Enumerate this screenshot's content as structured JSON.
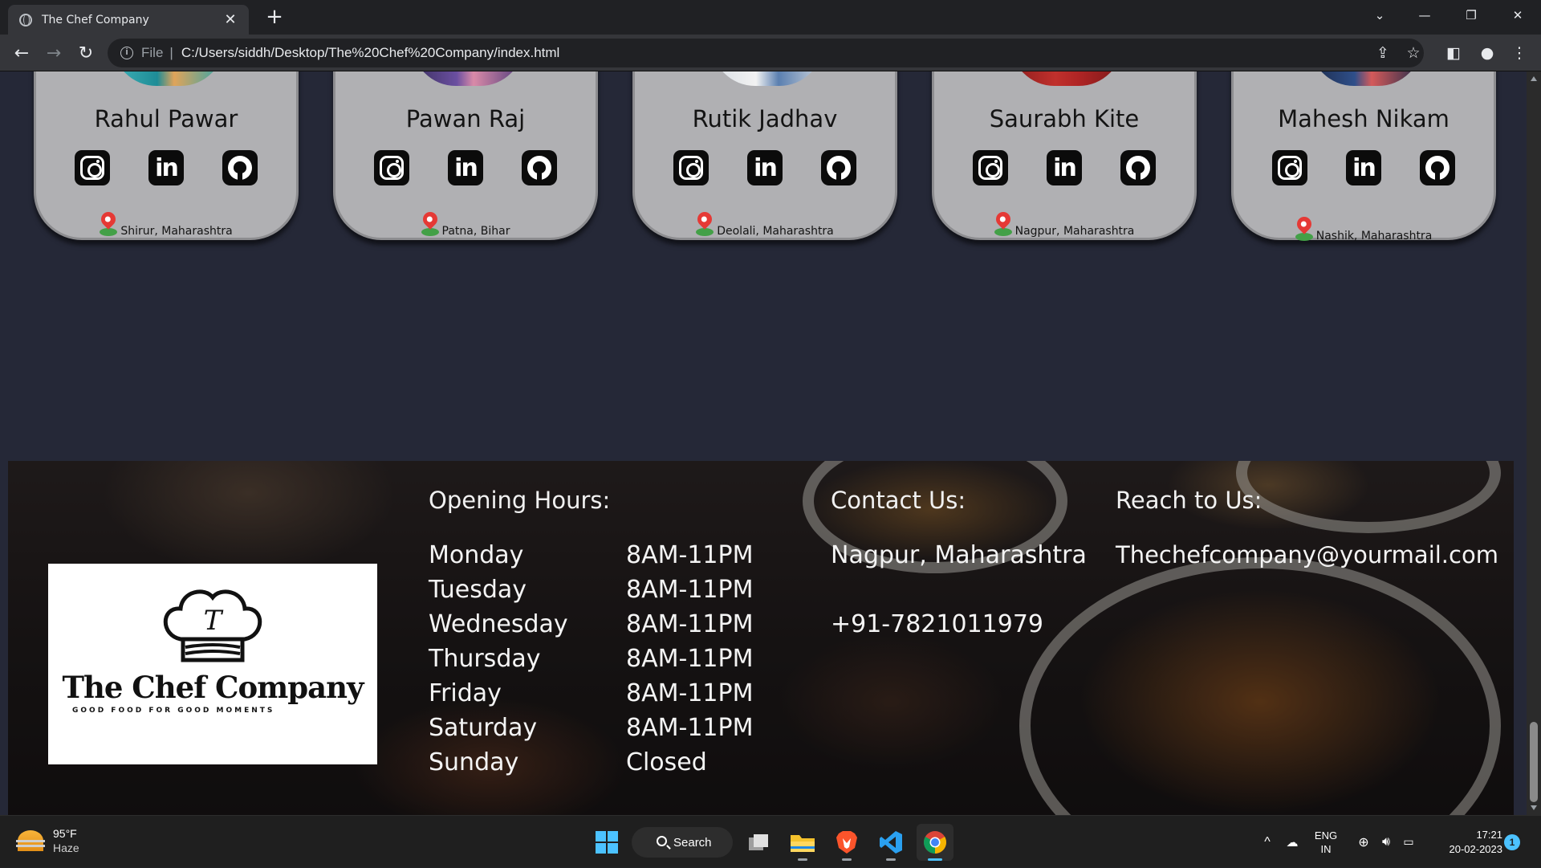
{
  "browser": {
    "tab_title": "The Chef Company",
    "url_scheme": "File",
    "url": "C:/Users/siddh/Desktop/The%20Chef%20Company/index.html"
  },
  "team": [
    {
      "name": "Rahul Pawar",
      "location": "Shirur, Maharashtra"
    },
    {
      "name": "Pawan Raj",
      "location": "Patna, Bihar"
    },
    {
      "name": "Rutik Jadhav",
      "location": "Deolali, Maharashtra"
    },
    {
      "name": "Saurabh Kite",
      "location": "Nagpur, Maharashtra"
    },
    {
      "name": "Mahesh Nikam",
      "location": "Nashik, Maharashtra"
    }
  ],
  "footer": {
    "logo": {
      "name": "The Chef Company",
      "tagline": "GOOD FOOD FOR GOOD MOMENTS"
    },
    "opening_hours": {
      "heading": "Opening Hours:",
      "rows": [
        {
          "day": "Monday",
          "time": "8AM-11PM"
        },
        {
          "day": "Tuesday",
          "time": "8AM-11PM"
        },
        {
          "day": "Wednesday",
          "time": "8AM-11PM"
        },
        {
          "day": "Thursday",
          "time": "8AM-11PM"
        },
        {
          "day": "Friday",
          "time": "8AM-11PM"
        },
        {
          "day": "Saturday",
          "time": "8AM-11PM"
        },
        {
          "day": "Sunday",
          "time": "Closed"
        }
      ]
    },
    "contact": {
      "heading": "Contact Us:",
      "address": "Nagpur, Maharashtra",
      "phone": "+91-7821011979"
    },
    "reach": {
      "heading": "Reach to Us:",
      "email": "Thechefcompany@yourmail.com"
    }
  },
  "taskbar": {
    "weather_temp": "95°F",
    "weather_desc": "Haze",
    "search_label": "Search",
    "lang_top": "ENG",
    "lang_bottom": "IN",
    "time": "17:21",
    "date": "20-02-2023",
    "notification_count": "1"
  },
  "colors": {
    "page_bg": "#252837",
    "card_bg": "#b0b0b3",
    "accent": "#4cc2ff"
  }
}
